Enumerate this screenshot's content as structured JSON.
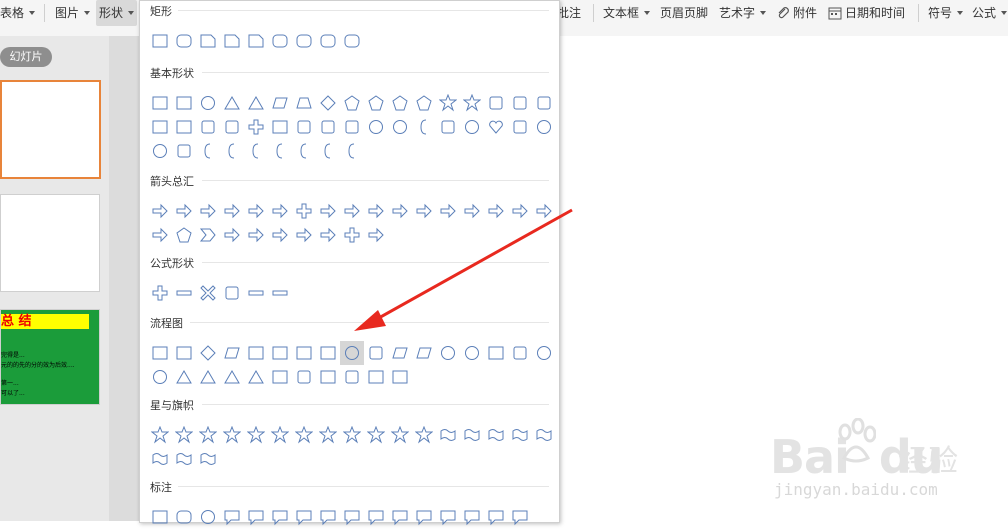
{
  "toolbar": {
    "items": [
      "表格",
      "图片",
      "形状",
      "批注",
      "文本框",
      "页眉页脚",
      "艺术字",
      "附件",
      "日期和时间",
      "符号",
      "公式"
    ]
  },
  "left_panel": {
    "tab_label": "幻灯片",
    "slide3": {
      "title": "总 结",
      "lines": [
        "完得是...",
        "元的的先的分的效为后效....",
        "第一...",
        "可以了..."
      ]
    }
  },
  "shapes_menu": {
    "sections": [
      {
        "name": "矩形",
        "shapes": [
          "rectangle",
          "rounded-rectangle",
          "snip-corner-rectangle",
          "snip-two-corner-rectangle",
          "snip-diagonal-rectangle",
          "round-snip-rectangle",
          "round-corner-rectangle",
          "round-two-corner-rectangle",
          "round-diagonal-rectangle"
        ]
      },
      {
        "name": "基本形状",
        "shapes": [
          "text-box",
          "vertical-text-box",
          "oval",
          "triangle",
          "right-triangle",
          "parallelogram",
          "trapezoid",
          "diamond",
          "pentagon",
          "hexagon",
          "heptagon",
          "octagon",
          "decagon",
          "dodecagon",
          "pie",
          "chord",
          "teardrop",
          "frame",
          "half-frame",
          "l-shape",
          "diagonal-stripe",
          "cross",
          "plaque",
          "can",
          "cube",
          "bevel",
          "donut",
          "no-symbol",
          "block-arc",
          "folded-corner",
          "smiley-face",
          "heart",
          "lightning-bolt",
          "sun",
          "moon",
          "cloud",
          "arc",
          "double-bracket",
          "double-brace",
          "left-bracket",
          "right-bracket",
          "left-brace",
          "right-brace"
        ]
      },
      {
        "name": "箭头总汇",
        "shapes": [
          "right-arrow",
          "left-arrow",
          "up-arrow",
          "down-arrow",
          "left-right-arrow",
          "up-down-arrow",
          "quad-arrow",
          "left-right-up-arrow",
          "bent-arrow",
          "u-turn-arrow",
          "left-up-arrow",
          "bent-up-arrow",
          "curved-right-arrow",
          "curved-left-arrow",
          "curved-up-arrow",
          "curved-down-arrow",
          "striped-right-arrow",
          "notched-right-arrow",
          "pentagon-arrow",
          "chevron",
          "right-arrow-callout",
          "left-arrow-callout",
          "up-arrow-callout",
          "down-arrow-callout",
          "left-right-arrow-callout",
          "quad-arrow-callout",
          "circular-arrow"
        ]
      },
      {
        "name": "公式形状",
        "shapes": [
          "plus",
          "minus",
          "multiply",
          "divide",
          "equal",
          "not-equal"
        ]
      },
      {
        "name": "流程图",
        "shapes": [
          "process",
          "alternate-process",
          "decision",
          "data",
          "predefined-process",
          "internal-storage",
          "document",
          "multidocument",
          "terminator",
          "preparation",
          "manual-input",
          "manual-operation",
          "connector",
          "off-page-connector",
          "card",
          "punched-tape",
          "summing-junction",
          "or",
          "collate",
          "sort",
          "extract",
          "merge",
          "stored-data",
          "delay",
          "sequential-access-storage",
          "magnetic-disk",
          "direct-access-storage",
          "display"
        ]
      },
      {
        "name": "星与旗帜",
        "shapes": [
          "explosion-1",
          "explosion-2",
          "4-point-star",
          "5-point-star",
          "6-point-star",
          "7-point-star",
          "8-point-star",
          "10-point-star",
          "12-point-star",
          "16-point-star",
          "24-point-star",
          "32-point-star",
          "up-ribbon",
          "down-ribbon",
          "curved-up-ribbon",
          "curved-down-ribbon",
          "vertical-scroll",
          "horizontal-scroll",
          "wave",
          "double-wave"
        ]
      },
      {
        "name": "标注",
        "shapes": [
          "rectangular-callout",
          "rounded-rectangular-callout",
          "oval-callout",
          "cloud-callout",
          "line-callout-1",
          "line-callout-2",
          "line-callout-3",
          "line-callout-1-accent",
          "line-callout-2-accent",
          "line-callout-3-accent",
          "line-callout-1-border",
          "line-callout-2-border",
          "line-callout-3-border",
          "line-callout-1-border-accent",
          "line-callout-2-border-accent",
          "line-callout-3-border-accent"
        ]
      }
    ],
    "highlighted_shape": "terminator"
  },
  "watermark": {
    "logo_text": "Bai",
    "logo_text_2": "du",
    "brand_cn": "经验",
    "url": "jingyan.baidu.com"
  },
  "colors": {
    "shape_stroke": "#5b7fb8",
    "accent_orange": "#e8843a",
    "arrow_red": "#e8291f",
    "slide3_green": "#1b9c3a",
    "slide3_yellow": "#ffff00"
  }
}
